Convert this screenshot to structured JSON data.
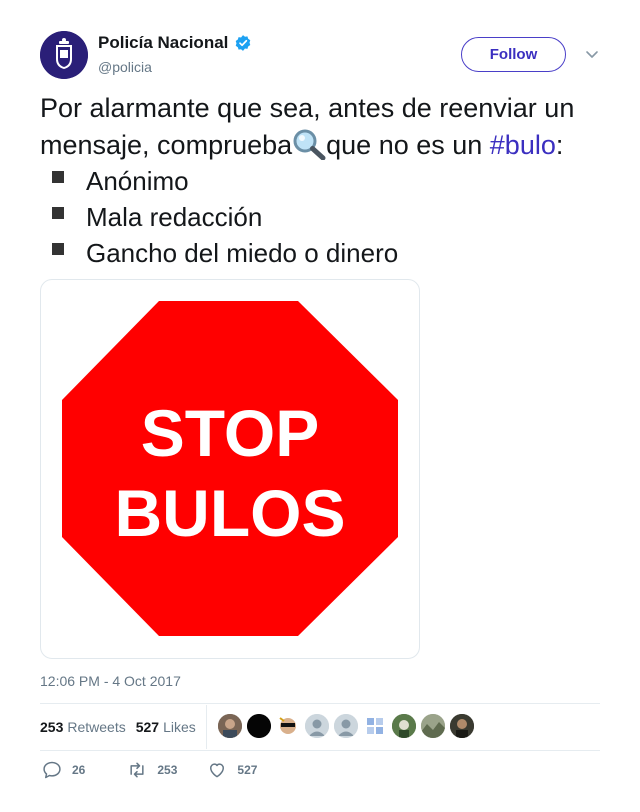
{
  "author": {
    "name": "Policía Nacional",
    "handle": "@policia",
    "follow_label": "Follow",
    "verified_color": "#1da1f2"
  },
  "tweet": {
    "line1": "Por alarmante que sea, antes de reenviar un mensaje, comprueba",
    "magnifier_icon": "magnifying-glass-icon",
    "line2": "que no es un ",
    "hashtag": "#bulo",
    "colon": ":",
    "bullets": [
      "Anónimo",
      "Mala redacción",
      "Gancho del miedo o dinero"
    ]
  },
  "media": {
    "sign_line1": "STOP",
    "sign_line2": "BULOS",
    "sign_color": "#ff0000"
  },
  "timestamp": "12:06 PM - 4 Oct 2017",
  "stats": {
    "retweets_count": "253",
    "retweets_label": "Retweets",
    "likes_count": "527",
    "likes_label": "Likes"
  },
  "actions": {
    "reply_count": "26",
    "retweet_count": "253",
    "like_count": "527"
  },
  "colors": {
    "accent": "#3b2fc0",
    "text_secondary": "#657786"
  }
}
